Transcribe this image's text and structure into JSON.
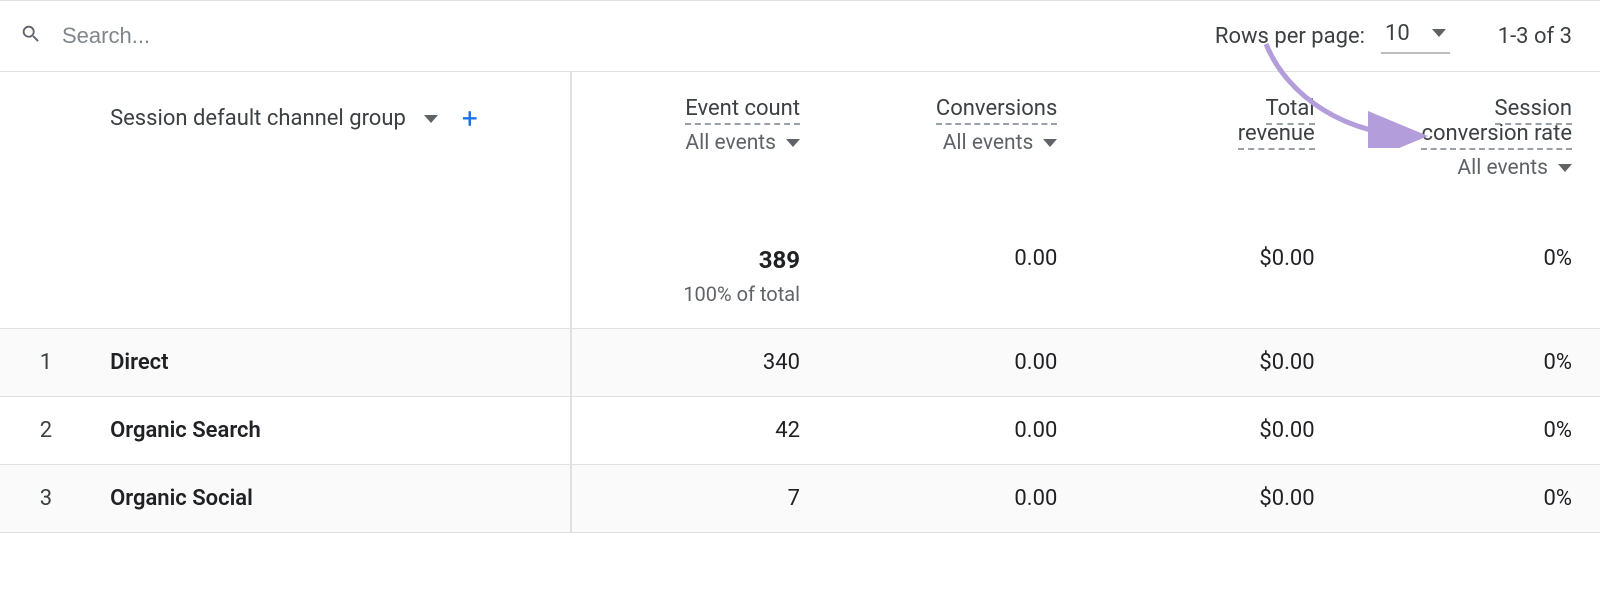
{
  "search": {
    "placeholder": "Search..."
  },
  "pagination": {
    "rows_per_page_label": "Rows per page:",
    "rows_per_page_value": "10",
    "range_text": "1-3 of 3"
  },
  "dimension": {
    "label": "Session default channel group"
  },
  "columns": {
    "event_count": {
      "label": "Event count",
      "filter": "All events"
    },
    "conversions": {
      "label": "Conversions",
      "filter": "All events"
    },
    "revenue": {
      "label_line1": "Total",
      "label_line2": "revenue"
    },
    "session_cr": {
      "label_line1": "Session",
      "label_line2": "conversion rate",
      "filter": "All events"
    }
  },
  "totals": {
    "event_count": "389",
    "event_count_sub": "100% of total",
    "conversions": "0.00",
    "revenue": "$0.00",
    "session_cr": "0%"
  },
  "rows": [
    {
      "idx": "1",
      "dim": "Direct",
      "event_count": "340",
      "conversions": "0.00",
      "revenue": "$0.00",
      "session_cr": "0%"
    },
    {
      "idx": "2",
      "dim": "Organic Search",
      "event_count": "42",
      "conversions": "0.00",
      "revenue": "$0.00",
      "session_cr": "0%"
    },
    {
      "idx": "3",
      "dim": "Organic Social",
      "event_count": "7",
      "conversions": "0.00",
      "revenue": "$0.00",
      "session_cr": "0%"
    }
  ],
  "annotation": {
    "arrow_color": "#b39ddb"
  }
}
